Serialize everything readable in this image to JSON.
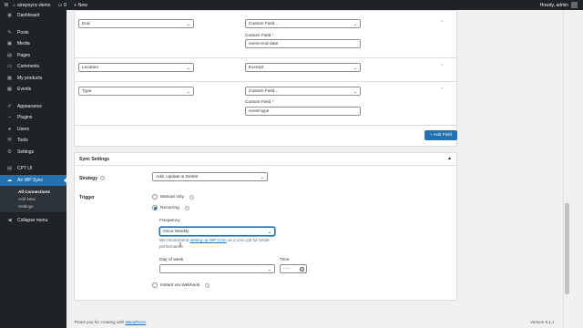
{
  "adminbar": {
    "site_name": "airwpsync-demo",
    "comments_count": "0",
    "new_label": "New",
    "howdy": "Howdy, admin"
  },
  "sidebar": {
    "items": [
      {
        "label": "Dashboard",
        "icon": "dashboard-icon",
        "glyph": "◉"
      },
      {
        "label": "Posts",
        "icon": "pin-icon",
        "glyph": "✎"
      },
      {
        "label": "Media",
        "icon": "media-icon",
        "glyph": "▣"
      },
      {
        "label": "Pages",
        "icon": "page-icon",
        "glyph": "▤"
      },
      {
        "label": "Comments",
        "icon": "comment-icon",
        "glyph": "▭"
      },
      {
        "label": "My products",
        "icon": "cart-icon",
        "glyph": "▦"
      },
      {
        "label": "Events",
        "icon": "calendar-icon",
        "glyph": "▦"
      },
      {
        "label": "Appearance",
        "icon": "brush-icon",
        "glyph": "✐"
      },
      {
        "label": "Plugins",
        "icon": "plugin-icon",
        "glyph": "⌁"
      },
      {
        "label": "Users",
        "icon": "user-icon",
        "glyph": "●"
      },
      {
        "label": "Tools",
        "icon": "wrench-icon",
        "glyph": "⚒"
      },
      {
        "label": "Settings",
        "icon": "settings-icon",
        "glyph": "⚙"
      },
      {
        "label": "CPT UI",
        "icon": "cpt-icon",
        "glyph": "▤"
      },
      {
        "label": "Air WP Sync",
        "icon": "cloud-icon",
        "glyph": "☁"
      }
    ],
    "submenu": [
      "All Connections",
      "Add New",
      "Settings"
    ],
    "collapse": "Collapse menu"
  },
  "mapping": {
    "rows": [
      {
        "source": "End",
        "type": "Custom Field...",
        "field_label": "Custom Field",
        "required": "*",
        "field_value": "event-end-date"
      },
      {
        "source": "Location",
        "type": "Excerpt"
      },
      {
        "source": "Type",
        "type": "Custom Field...",
        "field_label": "Custom Field",
        "required": "*",
        "field_value": "event-type"
      }
    ],
    "remove_glyph": "⌃",
    "add_field": "+ Add Field"
  },
  "sync": {
    "title": "Sync Settings",
    "strategy_label": "Strategy",
    "strategy_value": "Add, Update & Delete",
    "trigger_label": "Trigger",
    "manual_label": "Manual only",
    "recurring_label": "Recurring",
    "frequency_label": "Frequency",
    "frequency_value": "Once Weekly",
    "hint_before": "We recommend ",
    "hint_link": "setting up WP-Cron",
    "hint_after": " as a cron job for better performance.",
    "day_label": "Day of week",
    "day_value": "",
    "time_label": "Time",
    "time_value": "--:--",
    "webhook_label": "Instant via Webhook",
    "help_glyph": "?"
  },
  "footer": {
    "text_before": "Thank you for creating with ",
    "link": "WordPress",
    "text_after": ".",
    "version": "Version 6.1.1"
  }
}
